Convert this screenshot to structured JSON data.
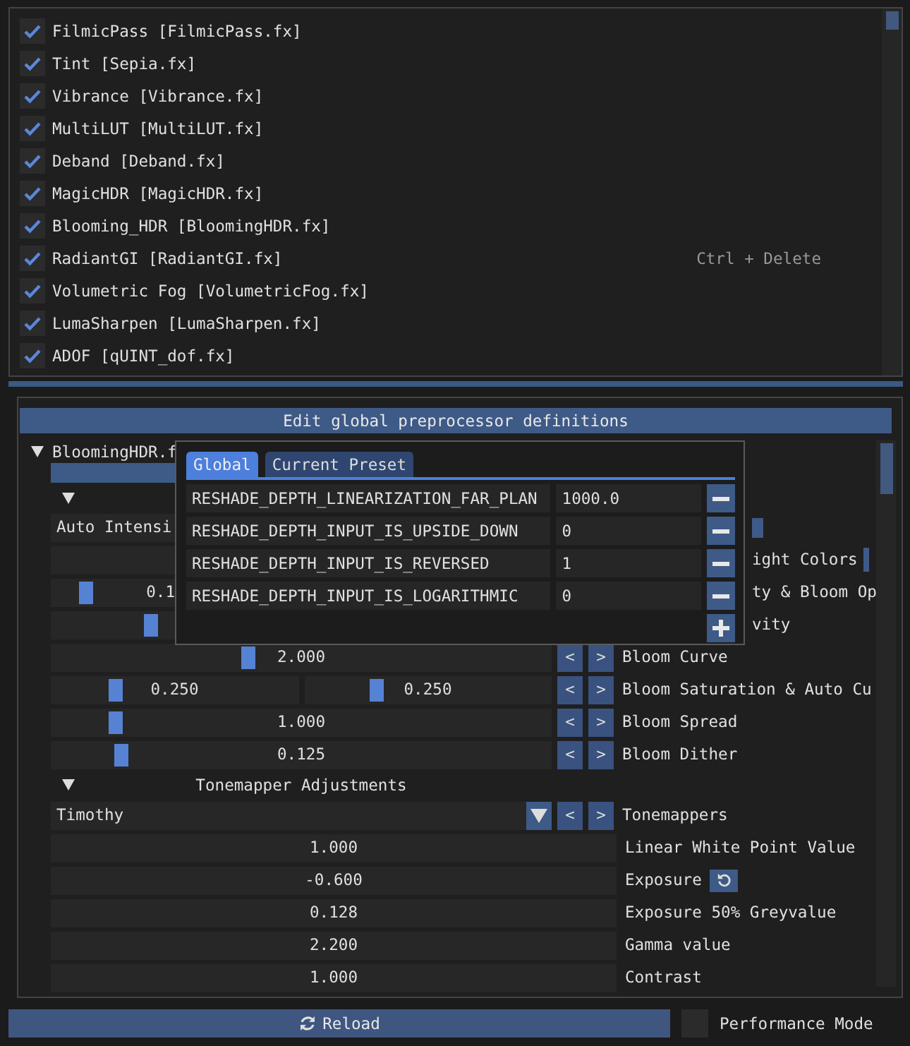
{
  "effects": [
    {
      "label": "FilmicPass [FilmicPass.fx]",
      "checked": true
    },
    {
      "label": "Tint [Sepia.fx]",
      "checked": true
    },
    {
      "label": "Vibrance [Vibrance.fx]",
      "checked": true
    },
    {
      "label": "MultiLUT [MultiLUT.fx]",
      "checked": true
    },
    {
      "label": "Deband [Deband.fx]",
      "checked": true
    },
    {
      "label": "MagicHDR [MagicHDR.fx]",
      "checked": true
    },
    {
      "label": "Blooming_HDR [BloomingHDR.fx]",
      "checked": true
    },
    {
      "label": "RadiantGI [RadiantGI.fx]",
      "checked": true,
      "shortcut": "Ctrl + Delete"
    },
    {
      "label": "Volumetric Fog [VolumetricFog.fx]",
      "checked": true
    },
    {
      "label": "LumaSharpen [LumaSharpen.fx]",
      "checked": true
    },
    {
      "label": "ADOF [qUINT_dof.fx]",
      "checked": true
    }
  ],
  "definitions_button": "Edit global preprocessor definitions",
  "effect_tree": {
    "label": "BloomingHDR.f",
    "expanded": true
  },
  "rows": [
    {
      "kind": "bar"
    },
    {
      "kind": "section",
      "expanded": true
    },
    {
      "kind": "cut_combo",
      "value": "Auto Intensi",
      "tail_reset": true
    },
    {
      "kind": "cut_field",
      "tail": "ight Colors",
      "tail_check": true
    },
    {
      "kind": "cut_slider",
      "level": 0.25,
      "value": "0.1",
      "tail": "ty & Bloom Op"
    },
    {
      "kind": "cut_slider",
      "level": 0.85,
      "tail": "vity"
    },
    {
      "kind": "slider",
      "level": 0.39,
      "value": "2.000",
      "buttons": [
        "<",
        ">"
      ],
      "label": "Bloom Curve"
    },
    {
      "kind": "slider2",
      "levels": [
        {
          "level": 0.25,
          "value": "0.250"
        },
        {
          "level": 0.28,
          "value": "0.250"
        }
      ],
      "buttons": [
        "<",
        ">"
      ],
      "label": "Bloom Saturation & Auto Cu"
    },
    {
      "kind": "slider",
      "level": 0.12,
      "value": "1.000",
      "buttons": [
        "<",
        ">"
      ],
      "label": "Bloom Spread"
    },
    {
      "kind": "slider",
      "level": 0.13,
      "value": "0.125",
      "buttons": [
        "<",
        ">"
      ],
      "label": "Bloom Dither"
    },
    {
      "kind": "section",
      "expanded": true,
      "title": "Tonemapper Adjustments"
    },
    {
      "kind": "combo",
      "value": "Timothy",
      "buttons": [
        "<",
        ">"
      ],
      "label": "Tonemappers"
    },
    {
      "kind": "field",
      "value": "1.000",
      "label": "Linear White Point Value"
    },
    {
      "kind": "field",
      "value": "-0.600",
      "label": "Exposure",
      "reset": true
    },
    {
      "kind": "field",
      "value": "0.128",
      "label": "Exposure 50% Greyvalue"
    },
    {
      "kind": "field",
      "value": "2.200",
      "label": "Gamma value"
    },
    {
      "kind": "field",
      "value": "1.000",
      "label": "Contrast"
    }
  ],
  "popup": {
    "tabs": [
      {
        "label": "Global",
        "selected": true
      },
      {
        "label": "Current Preset",
        "selected": false
      }
    ],
    "definitions": [
      {
        "name": "RESHADE_DEPTH_LINEARIZATION_FAR_PLAN",
        "value": "1000.0"
      },
      {
        "name": "RESHADE_DEPTH_INPUT_IS_UPSIDE_DOWN",
        "value": "0"
      },
      {
        "name": "RESHADE_DEPTH_INPUT_IS_REVERSED",
        "value": "1"
      },
      {
        "name": "RESHADE_DEPTH_INPUT_IS_LOGARITHMIC",
        "value": "0"
      }
    ]
  },
  "reload_button": "Reload",
  "performance_mode": {
    "label": "Performance Mode",
    "checked": false
  }
}
